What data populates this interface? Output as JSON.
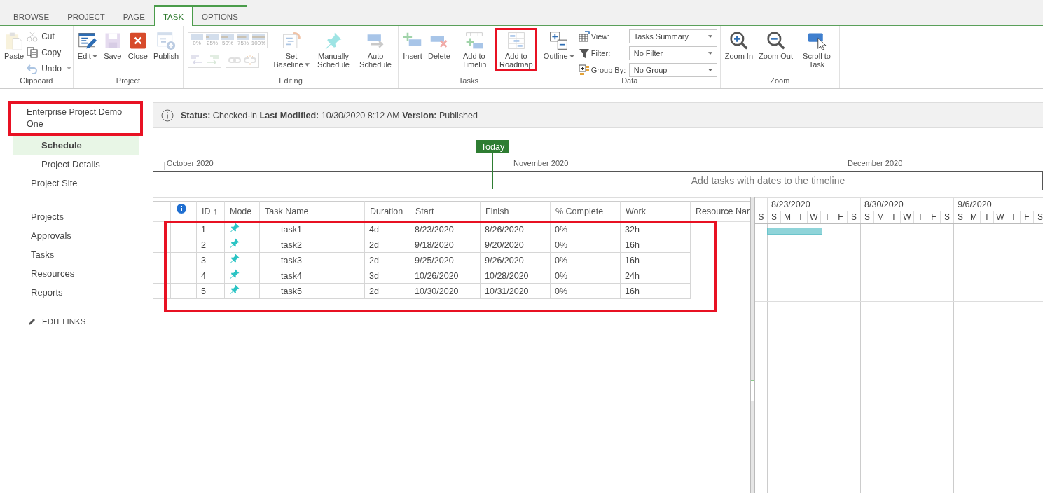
{
  "ribbon": {
    "tabs": [
      {
        "label": "BROWSE",
        "selected": false,
        "contextual": false
      },
      {
        "label": "PROJECT",
        "selected": false,
        "contextual": false
      },
      {
        "label": "PAGE",
        "selected": false,
        "contextual": false
      },
      {
        "label": "TASK",
        "selected": true,
        "contextual": true
      },
      {
        "label": "OPTIONS",
        "selected": false,
        "contextual": true
      }
    ],
    "groups": [
      {
        "label": "Clipboard",
        "items": [
          {
            "kind": "large",
            "label": "Paste",
            "disabled": true,
            "dropdown": false,
            "highlighted": false
          },
          {
            "kind": "stack",
            "items": [
              {
                "label": "Cut",
                "disabled": true,
                "dropdown": false
              },
              {
                "label": "Copy",
                "disabled": false,
                "dropdown": false
              },
              {
                "label": "Undo",
                "disabled": true,
                "dropdown": true
              }
            ]
          }
        ]
      },
      {
        "label": "Project",
        "items": [
          {
            "kind": "large",
            "label": "Edit",
            "disabled": false,
            "dropdown": true,
            "highlighted": false
          },
          {
            "kind": "large",
            "label": "Save",
            "disabled": true,
            "dropdown": false,
            "highlighted": false
          },
          {
            "kind": "large",
            "label": "Close",
            "disabled": false,
            "dropdown": false,
            "highlighted": false
          },
          {
            "kind": "large",
            "label": "Publish",
            "disabled": true,
            "dropdown": false,
            "highlighted": false
          }
        ]
      },
      {
        "label": "Editing",
        "items": [
          {
            "kind": "tools",
            "percents": [
              "0%",
              "25%",
              "50%",
              "75%",
              "100%"
            ],
            "disabled": true
          },
          {
            "kind": "large",
            "label": "Set Baseline",
            "disabled": true,
            "dropdown": true,
            "highlighted": false
          },
          {
            "kind": "large",
            "label": "Manually Schedule",
            "disabled": true,
            "dropdown": false,
            "highlighted": false
          },
          {
            "kind": "large",
            "label": "Auto Schedule",
            "disabled": true,
            "dropdown": false,
            "highlighted": false
          }
        ]
      },
      {
        "label": "Tasks",
        "items": [
          {
            "kind": "large",
            "label": "Insert",
            "disabled": true,
            "dropdown": false,
            "highlighted": false
          },
          {
            "kind": "large",
            "label": "Delete",
            "disabled": true,
            "dropdown": false,
            "highlighted": false
          },
          {
            "kind": "large",
            "label": "Add to Timelin",
            "disabled": true,
            "dropdown": false,
            "highlighted": false
          },
          {
            "kind": "large",
            "label": "Add to Roadmap",
            "disabled": true,
            "dropdown": false,
            "highlighted": true
          }
        ]
      },
      {
        "label": "Data",
        "items": [
          {
            "kind": "large",
            "label": "Outline",
            "disabled": false,
            "dropdown": true,
            "highlighted": false
          },
          {
            "kind": "fields",
            "items": [
              {
                "label": "View:",
                "value": "Tasks Summary"
              },
              {
                "label": "Filter:",
                "value": "No Filter"
              },
              {
                "label": "Group By:",
                "value": "No Group"
              }
            ]
          }
        ]
      },
      {
        "label": "Zoom",
        "items": [
          {
            "kind": "large",
            "label": "Zoom In",
            "disabled": false,
            "dropdown": false,
            "highlighted": false
          },
          {
            "kind": "large",
            "label": "Zoom Out",
            "disabled": false,
            "dropdown": false,
            "highlighted": false
          },
          {
            "kind": "large",
            "label": "Scroll to Task",
            "disabled": false,
            "dropdown": false,
            "highlighted": false
          }
        ]
      }
    ]
  },
  "nav": {
    "sections": [
      {
        "items": [
          {
            "label": "Enterprise Project Demo One",
            "selected": false,
            "highlighted": true,
            "children": [
              {
                "label": "Schedule",
                "selected": true
              },
              {
                "label": "Project Details",
                "selected": false
              }
            ]
          },
          {
            "label": "Project Site",
            "selected": false,
            "highlighted": false
          }
        ]
      },
      {
        "items": [
          {
            "label": "Projects",
            "selected": false,
            "highlighted": false
          },
          {
            "label": "Approvals",
            "selected": false,
            "highlighted": false
          },
          {
            "label": "Tasks",
            "selected": false,
            "highlighted": false
          },
          {
            "label": "Resources",
            "selected": false,
            "highlighted": false
          },
          {
            "label": "Reports",
            "selected": false,
            "highlighted": false
          }
        ]
      }
    ],
    "edit_links": "EDIT LINKS"
  },
  "status": "**Status:** Checked-in **Last Modified:** 10/30/2020 8:12 AM **Version:** Published",
  "timeline": {
    "today": "Today",
    "months": [
      "October 2020",
      "November 2020",
      "December 2020"
    ],
    "empty_message": "Add tasks with dates to the timeline"
  },
  "grid": {
    "highlighted": true,
    "columns": [
      {
        "label": "ID ↑"
      },
      {
        "label": "Mode"
      },
      {
        "label": "Task Name"
      },
      {
        "label": "Duration"
      },
      {
        "label": "Start"
      },
      {
        "label": "Finish"
      },
      {
        "label": "% Complete"
      },
      {
        "label": "Work"
      },
      {
        "label": "Resource Nar"
      }
    ],
    "rows": [
      {
        "id": "1",
        "name": "task1",
        "duration": "4d",
        "start": "8/23/2020",
        "finish": "8/26/2020",
        "complete": "0%",
        "work": "32h"
      },
      {
        "id": "2",
        "name": "task2",
        "duration": "2d",
        "start": "9/18/2020",
        "finish": "9/20/2020",
        "complete": "0%",
        "work": "16h"
      },
      {
        "id": "3",
        "name": "task3",
        "duration": "2d",
        "start": "9/25/2020",
        "finish": "9/26/2020",
        "complete": "0%",
        "work": "16h"
      },
      {
        "id": "4",
        "name": "task4",
        "duration": "3d",
        "start": "10/26/2020",
        "finish": "10/28/2020",
        "complete": "0%",
        "work": "24h"
      },
      {
        "id": "5",
        "name": "task5",
        "duration": "2d",
        "start": "10/30/2020",
        "finish": "10/31/2020",
        "complete": "0%",
        "work": "16h"
      }
    ]
  },
  "gantt": {
    "weeks": [
      "8/23/2020",
      "8/30/2020",
      "9/6/2020"
    ],
    "days": [
      "S",
      "S",
      "M",
      "T",
      "W",
      "T",
      "F",
      "S",
      "S",
      "M",
      "T",
      "W",
      "T",
      "F",
      "S",
      "S",
      "M",
      "T",
      "W",
      "T",
      "F",
      "S"
    ]
  }
}
